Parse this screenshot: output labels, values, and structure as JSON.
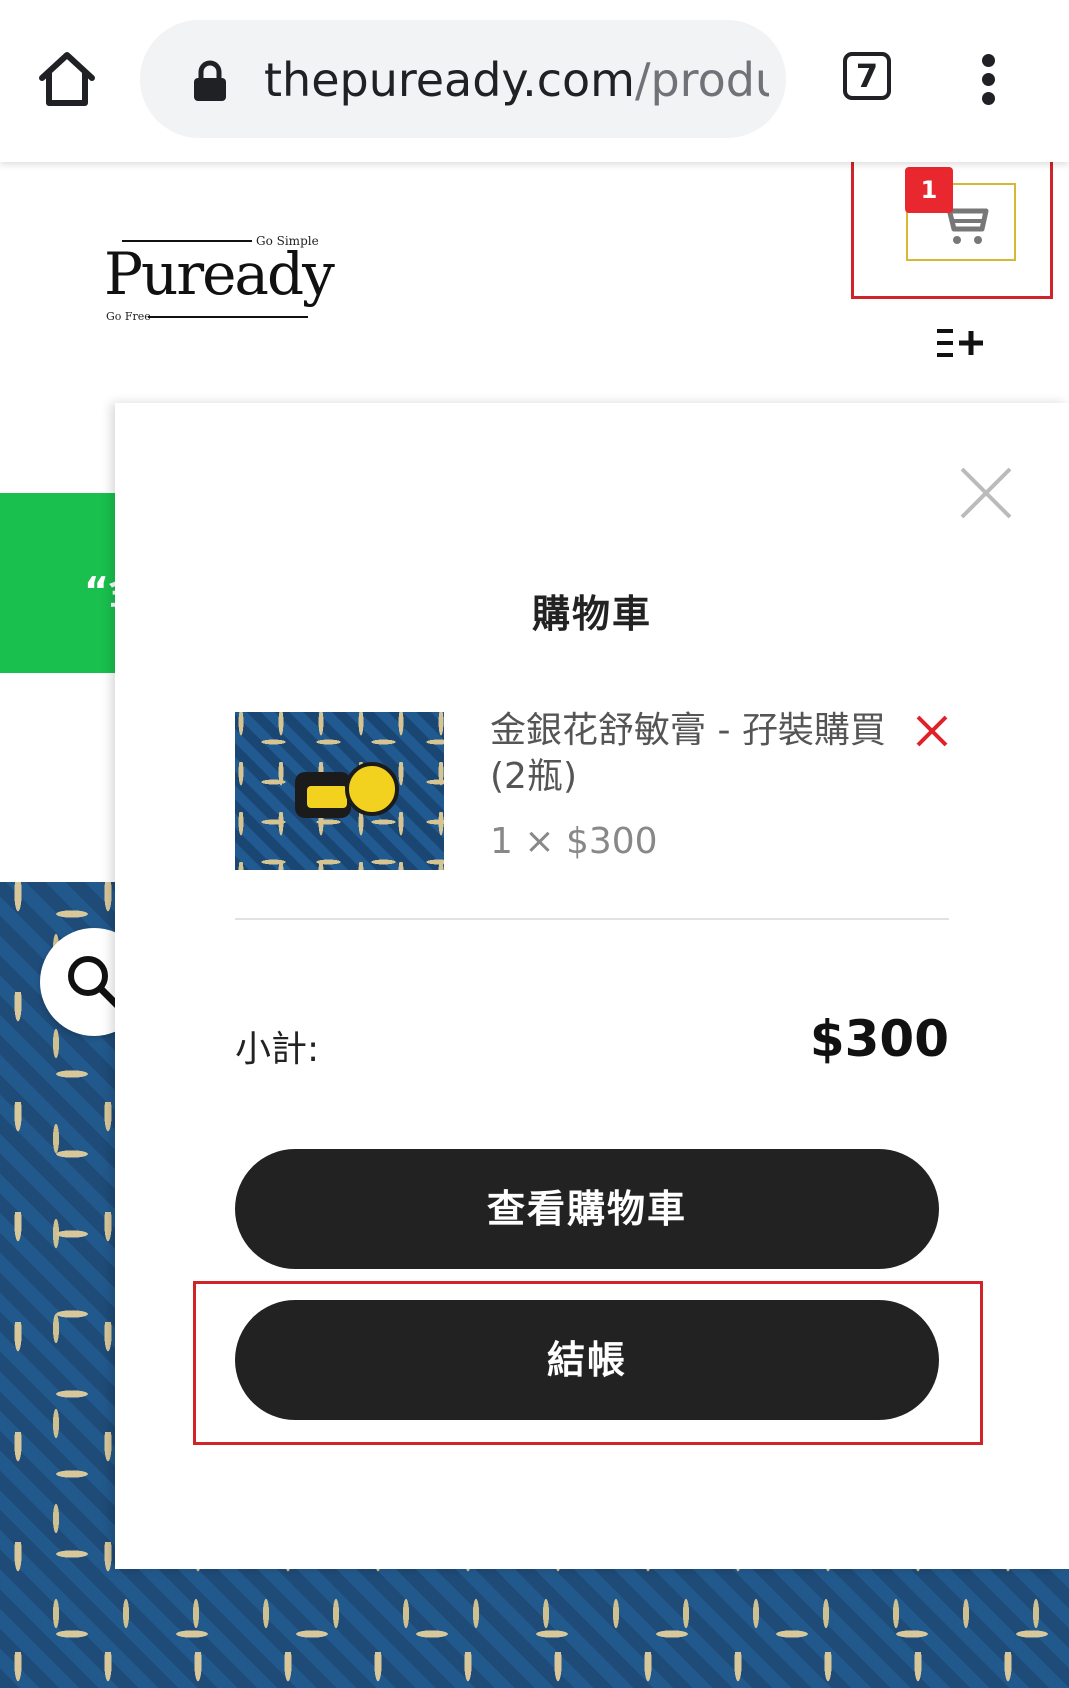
{
  "browser": {
    "url_host": "thepuready.com",
    "url_path": "/produ",
    "tab_count": "7",
    "icons": {
      "home": "home-icon",
      "lock": "lock-icon",
      "menu": "kebab-menu-icon"
    }
  },
  "site": {
    "logo": {
      "brand": "Puready",
      "tagline_top": "Go Simple",
      "tagline_bottom": "Go Free"
    },
    "cart_badge": "1",
    "banner_fragment": "“金"
  },
  "drawer": {
    "title": "購物車",
    "item": {
      "name": "金銀花舒敏膏 - 孖裝購買(2瓶)",
      "qty_price": "1 × $300"
    },
    "subtotal_label": "小計:",
    "subtotal_value": "$300",
    "view_cart_label": "查看購物車",
    "checkout_label": "結帳"
  },
  "colors": {
    "accent_red": "#d1232a",
    "badge_red": "#e8282e",
    "button_dark": "#222222",
    "banner_green": "#19c04e",
    "cart_border": "#d8b733"
  }
}
